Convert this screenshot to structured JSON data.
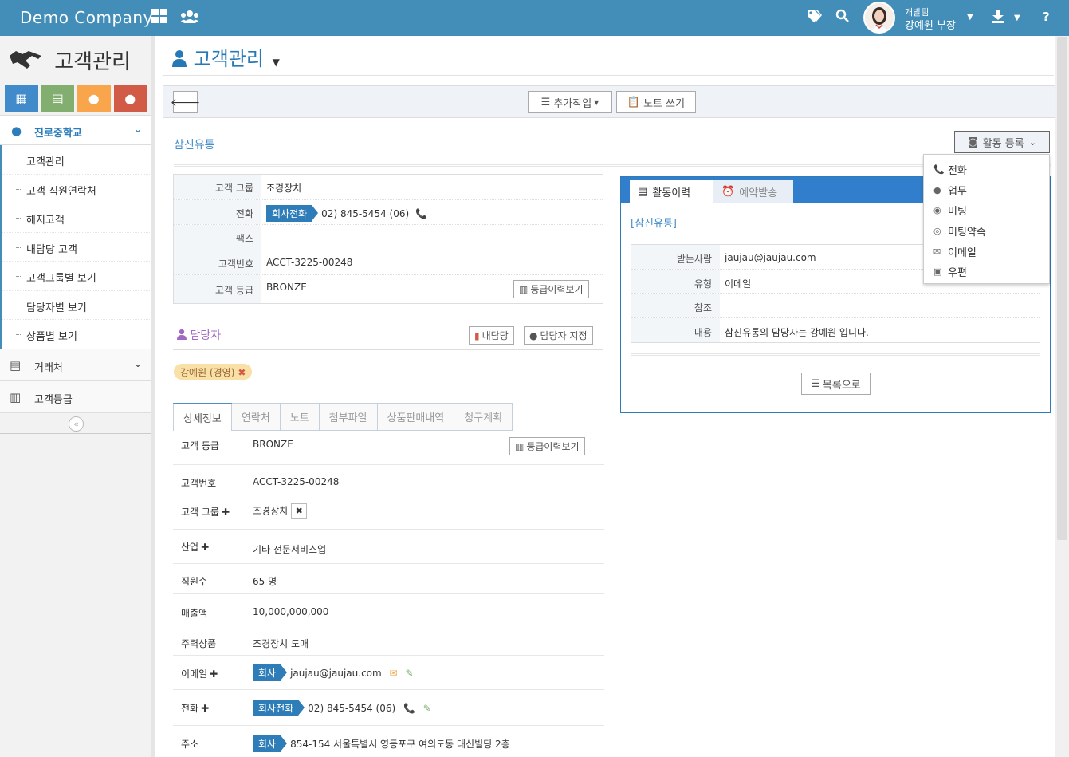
{
  "topbar": {
    "brand": "Demo Company",
    "grid_icon": "grid-icon",
    "users_icon": "users-icon",
    "user_team": "개발팀",
    "user_name": "강예원 부장",
    "help": "?"
  },
  "sidebar": {
    "title": "고객관리",
    "menu_top": "진로중학교",
    "sub_items": [
      "고객관리",
      "고객 직원연락처",
      "해지고객",
      "내담당 고객",
      "고객그룹별 보기",
      "담당자별 보기",
      "상품별 보기"
    ],
    "item_partner": "거래처",
    "item_grade": "고객등급"
  },
  "page": {
    "title": "고객관리"
  },
  "toolbar": {
    "extra_label": "추가작업",
    "note_label": "노트 쓰기"
  },
  "customer": {
    "name": "삼진유통",
    "activity_register": "활동 등록"
  },
  "info": {
    "labels": [
      "고객 그룹",
      "전화",
      "팩스",
      "고객번호",
      "고객 등급"
    ],
    "group": "조경장치",
    "phone_tag": "회사전화",
    "phone": "02) 845-5454 (06)",
    "fax": "",
    "cust_no": "ACCT-3225-00248",
    "grade": "BRONZE",
    "grade_history": "등급이력보기"
  },
  "manager": {
    "title": "담당자",
    "my_btn": "내담당",
    "assign_btn": "담당자 지정",
    "chip": "강예원 (경영)"
  },
  "tabs": [
    "상세정보",
    "연락처",
    "노트",
    "첨부파일",
    "상품판매내역",
    "청구계획"
  ],
  "detail": {
    "grade_label": "고객 등급",
    "grade_val": "BRONZE",
    "grade_history": "등급이력보기",
    "custno_label": "고객번호",
    "custno_val": "ACCT-3225-00248",
    "group_label": "고객 그룹",
    "group_val": "조경장치",
    "industry_label": "산업",
    "industry_val": "기타 전문서비스업",
    "staff_label": "직원수",
    "staff_val": "65 명",
    "sales_label": "매출액",
    "sales_val": "10,000,000,000",
    "product_label": "주력상품",
    "product_val": "조경장치 도매",
    "email_label": "이메일",
    "email_tag": "회사",
    "email_val": "jaujau@jaujau.com",
    "phone_label": "전화",
    "phone_tag": "회사전화",
    "phone_val": "02) 845-5454 (06)",
    "addr_label": "주소",
    "addr_tag": "회사",
    "addr_val": "854-154 서울특별시 영등포구 여의도동 대신빌딩 2층"
  },
  "right_panel": {
    "tab_history": "활동이력",
    "tab_reserve": "예약발송",
    "subtitle": "[삼진유통]",
    "rows": [
      {
        "label": "받는사람",
        "value": "jaujau@jaujau.com"
      },
      {
        "label": "유형",
        "value": "이메일"
      },
      {
        "label": "참조",
        "value": ""
      },
      {
        "label": "내용",
        "value": "삼진유통의 담당자는 강예원 입니다."
      }
    ],
    "list_btn": "목록으로"
  },
  "dropdown": {
    "items": [
      {
        "label": "전화",
        "icon": "phone-icon"
      },
      {
        "label": "업무",
        "icon": "user-task-icon"
      },
      {
        "label": "미팅",
        "icon": "meeting-icon"
      },
      {
        "label": "미팅약속",
        "icon": "meeting-appointment-icon"
      },
      {
        "label": "이메일",
        "icon": "envelope-icon"
      },
      {
        "label": "우편",
        "icon": "mailbox-icon"
      }
    ]
  },
  "colors": {
    "topbar": "#438eb9",
    "accent": "#2e7db8",
    "shortcut_blue": "#428bca",
    "shortcut_green": "#82af6f",
    "shortcut_orange": "#f8a54b",
    "shortcut_red": "#d15b47"
  }
}
